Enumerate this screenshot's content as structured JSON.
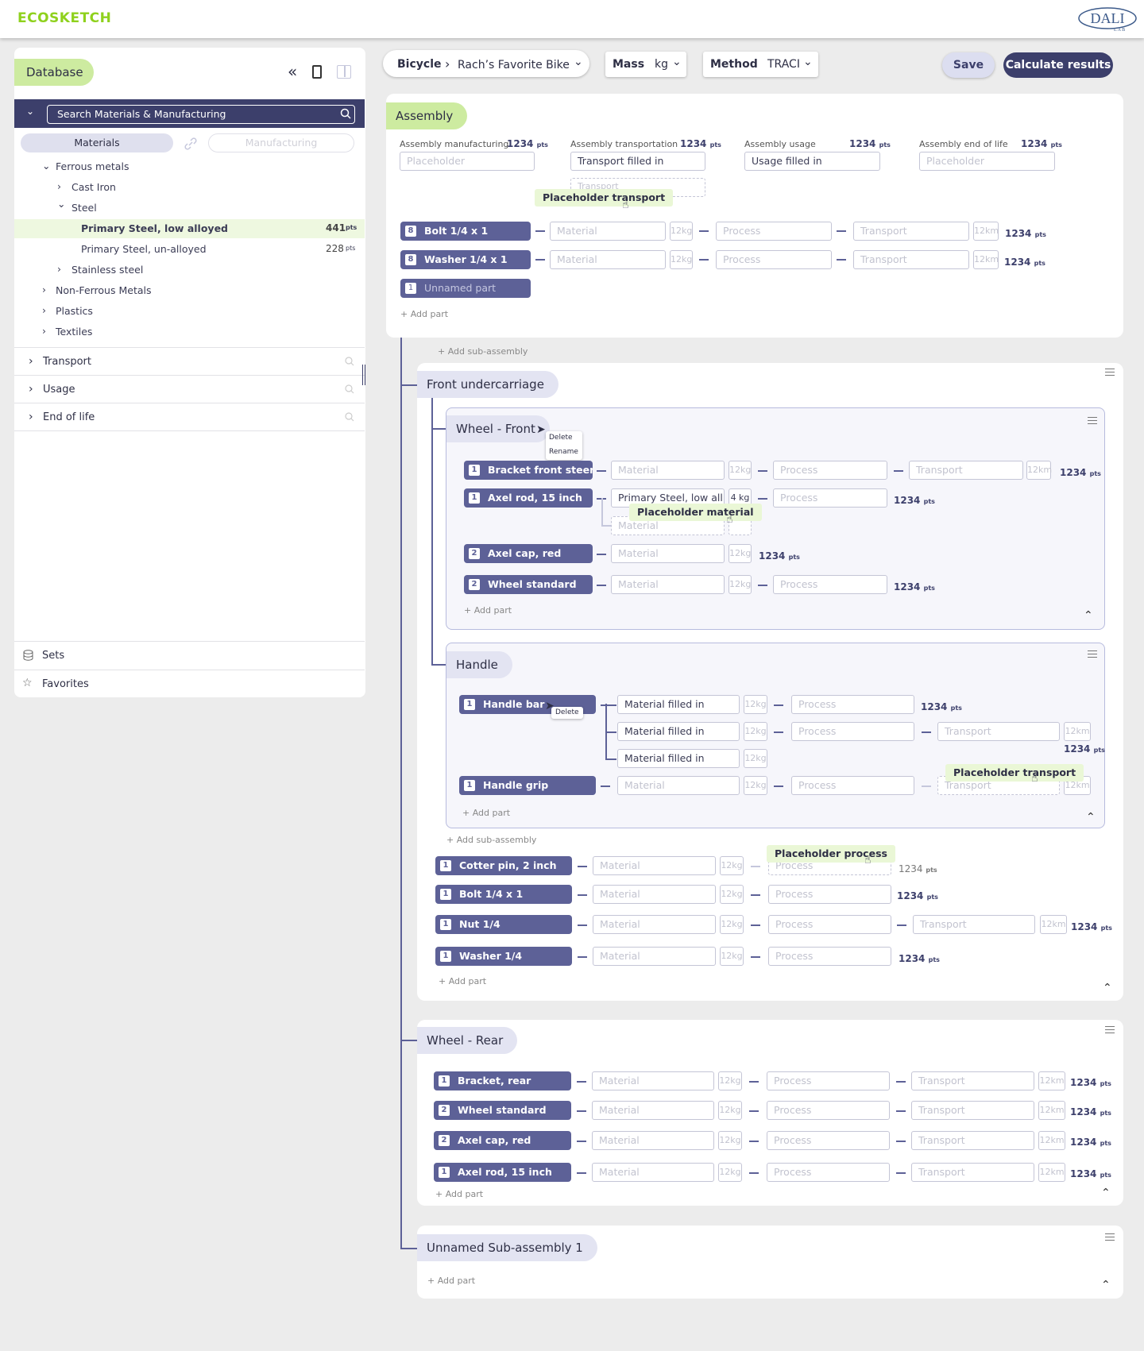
{
  "app": {
    "logo": "ECOSKETCH",
    "partner_logo": "DALI LAB"
  },
  "header": {
    "product": "Bicycle",
    "variant": "Rach’s Favorite Bike",
    "mass_label": "Mass",
    "mass_unit": "kg",
    "method_label": "Method",
    "method_value": "TRACI",
    "save": "Save",
    "calculate": "Calculate results"
  },
  "sidebar": {
    "title": "Database",
    "search_placeholder": "Search Materials & Manufacturing",
    "tabs": [
      "Materials",
      "Manufacturing"
    ],
    "tree": [
      {
        "label": "Ferrous metals"
      },
      {
        "label": "Cast Iron"
      },
      {
        "label": "Steel"
      },
      {
        "label": "Primary Steel, low alloyed",
        "pts": "441",
        "unit": "pts"
      },
      {
        "label": "Primary Steel, un-alloyed",
        "pts": "228",
        "unit": "pts"
      },
      {
        "label": "Stainless steel"
      },
      {
        "label": "Non-Ferrous Metals"
      },
      {
        "label": "Plastics"
      },
      {
        "label": "Textiles"
      }
    ],
    "sections": [
      "Transport",
      "Usage",
      "End of life"
    ],
    "footer": [
      "Sets",
      "Favorites"
    ]
  },
  "assembly": {
    "title": "Assembly",
    "fields": [
      {
        "label": "Assembly manufacturing",
        "pts": "1234",
        "value": "Placeholder"
      },
      {
        "label": "Assembly transportation",
        "pts": "1234",
        "value": "Transport filled in",
        "ghost": "Transport"
      },
      {
        "label": "Assembly usage",
        "pts": "1234",
        "value": "Usage filled in"
      },
      {
        "label": "Assembly end of life",
        "pts": "1234",
        "value": "Placeholder"
      }
    ],
    "tooltip": "Placeholder transport",
    "parts": [
      {
        "qty": "8",
        "name": "Bolt 1/4 x 1",
        "pts": "1234"
      },
      {
        "qty": "8",
        "name": "Washer 1/4 x 1",
        "pts": "1234"
      },
      {
        "qty": "1",
        "name": "Unnamed part"
      }
    ],
    "add_part": "+ Add part",
    "add_sub": "+ Add sub-assembly"
  },
  "common": {
    "material": "Material",
    "process": "Process",
    "transport": "Transport",
    "kg": "12kg",
    "km": "12km",
    "pts_unit": "pts",
    "add_part": "+ Add part",
    "add_sub": "+ Add sub-assembly",
    "delete": "Delete",
    "rename": "Rename"
  },
  "front": {
    "title": "Front undercarriage",
    "wheel": {
      "title": "Wheel - Front",
      "parts": [
        {
          "qty": "1",
          "name": "Bracket front steeri...",
          "pts": "1234"
        },
        {
          "qty": "1",
          "name": "Axel rod, 15 inch",
          "material": "Primary Steel, low all...",
          "mass": "4 kg",
          "pts": "1234"
        },
        {
          "qty": "2",
          "name": "Axel cap, red",
          "pts": "1234"
        },
        {
          "qty": "2",
          "name": "Wheel standard",
          "pts": "1234"
        }
      ],
      "tooltip": "Placeholder material"
    },
    "handle": {
      "title": "Handle",
      "parts": [
        {
          "qty": "1",
          "name": "Handle bar",
          "pts": "1234"
        },
        {
          "qty": "1",
          "name": "Handle grip"
        }
      ],
      "filled": "Material filled in",
      "pts2": "1234",
      "tooltip": "Placeholder transport"
    },
    "parts": [
      {
        "qty": "1",
        "name": "Cotter pin, 2 inch",
        "pts": "1234"
      },
      {
        "qty": "1",
        "name": "Bolt 1/4 x 1",
        "pts": "1234"
      },
      {
        "qty": "1",
        "name": "Nut 1/4",
        "pts": "1234"
      },
      {
        "qty": "1",
        "name": "Washer 1/4",
        "pts": "1234"
      }
    ],
    "tooltip": "Placeholder process"
  },
  "rear": {
    "title": "Wheel - Rear",
    "parts": [
      {
        "qty": "1",
        "name": "Bracket, rear",
        "pts": "1234"
      },
      {
        "qty": "2",
        "name": "Wheel standard",
        "pts": "1234"
      },
      {
        "qty": "2",
        "name": "Axel cap, red",
        "pts": "1234"
      },
      {
        "qty": "1",
        "name": "Axel rod, 15 inch",
        "pts": "1234"
      }
    ]
  },
  "unnamed": {
    "title": "Unnamed Sub-assembly 1"
  },
  "colors": {
    "accent": "#8fd11d",
    "navy": "#3c3f6b",
    "part": "#5d6197",
    "pill_green": "#cdeba0"
  }
}
